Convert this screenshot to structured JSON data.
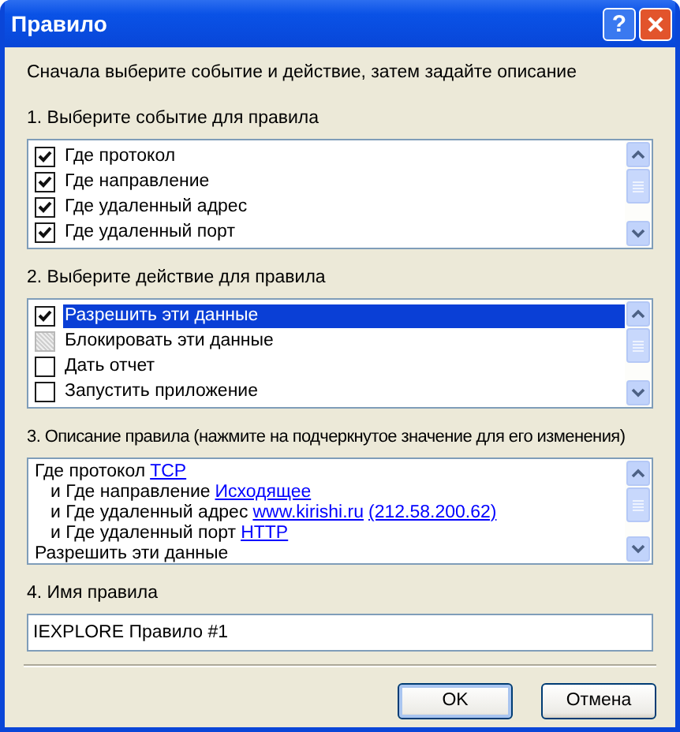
{
  "window": {
    "title": "Правило",
    "buttons": [
      {
        "kind": "help",
        "label": "?"
      }
    ]
  },
  "intro": "Сначала выберите событие и действие, затем задайте описание",
  "events": {
    "label": "1. Выберите событие для правила",
    "items": [
      {
        "text": "Где протокол",
        "checked": true,
        "disabled": false,
        "selected": false
      },
      {
        "text": "Где направление",
        "checked": true,
        "disabled": false,
        "selected": false
      },
      {
        "text": "Где удаленный адрес",
        "checked": true,
        "disabled": false,
        "selected": false
      },
      {
        "text": "Где удаленный порт",
        "checked": true,
        "disabled": false,
        "selected": false
      }
    ]
  },
  "actions": {
    "label": "2. Выберите действие для правила",
    "items": [
      {
        "text": "Разрешить эти данные",
        "checked": true,
        "disabled": false,
        "selected": true
      },
      {
        "text": "Блокировать эти данные",
        "checked": false,
        "disabled": true,
        "selected": false
      },
      {
        "text": "Дать отчет",
        "checked": false,
        "disabled": false,
        "selected": false
      },
      {
        "text": "Запустить приложение",
        "checked": false,
        "disabled": false,
        "selected": false
      }
    ]
  },
  "description": {
    "label": "3. Описание правила (нажмите на подчеркнутое значение для его изменения)",
    "lines": [
      {
        "indented": false,
        "segments": [
          {
            "kind": "text",
            "text": "Где протокол"
          },
          {
            "kind": "link",
            "text": "TCP"
          }
        ]
      },
      {
        "indented": true,
        "segments": [
          {
            "kind": "text",
            "text": "и Где направление"
          },
          {
            "kind": "link",
            "text": "Исходящее"
          }
        ]
      },
      {
        "indented": true,
        "segments": [
          {
            "kind": "text",
            "text": "и Где удаленный адрес"
          },
          {
            "kind": "link",
            "text": "www.kirishi.ru"
          },
          {
            "kind": "link",
            "text": "(212.58.200.62)"
          }
        ]
      },
      {
        "indented": true,
        "segments": [
          {
            "kind": "text",
            "text": "и Где удаленный порт"
          },
          {
            "kind": "link",
            "text": "HTTP"
          }
        ]
      },
      {
        "indented": false,
        "segments": [
          {
            "kind": "text",
            "text": "Разрешить эти данные"
          }
        ]
      }
    ]
  },
  "name": {
    "label": "4. Имя правила",
    "value": "IEXPLORE Правило #1"
  },
  "buttons": [
    {
      "label": "OK",
      "default": true
    },
    {
      "label": "Отмена",
      "default": false
    }
  ]
}
